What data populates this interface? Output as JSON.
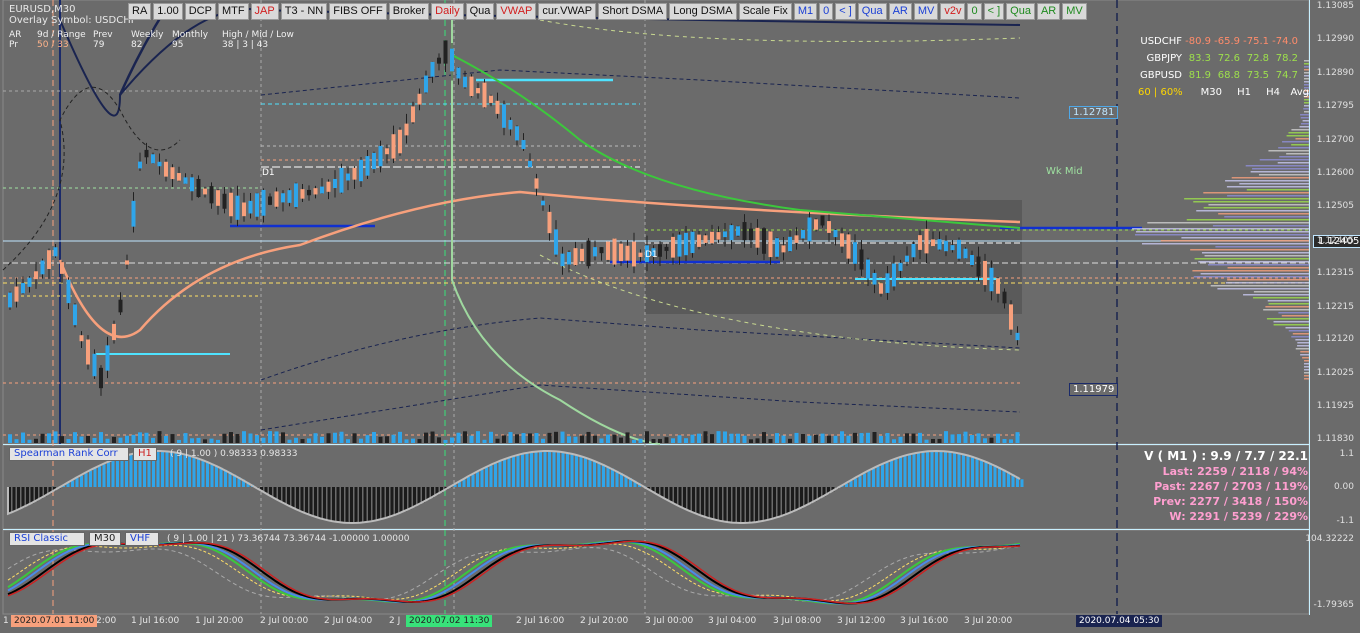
{
  "symbol_info": {
    "title": "EURUSD,M30",
    "overlay": "Overlay Symbol: USDCHF"
  },
  "stats": {
    "headers": [
      "AR",
      "9d / Range",
      "Prev",
      "Weekly",
      "Monthly",
      "High / Mid / Low"
    ],
    "row_label": "Pr",
    "values": [
      "50 / 33",
      "79",
      "82",
      "95",
      "38 | 3 | 43"
    ]
  },
  "toolbar": [
    {
      "label": "RA",
      "color": "dark"
    },
    {
      "label": "1.00",
      "color": "dark"
    },
    {
      "label": "DCP",
      "color": "dark"
    },
    {
      "label": "MTF",
      "color": "dark"
    },
    {
      "label": "JAP",
      "color": "red"
    },
    {
      "label": "T3 - NN",
      "color": "dark"
    },
    {
      "label": "FIBS OFF",
      "color": "dark"
    },
    {
      "label": "Broker",
      "color": "dark"
    },
    {
      "label": "Daily",
      "color": "red"
    },
    {
      "label": "Qua",
      "color": "dark"
    },
    {
      "label": "VWAP",
      "color": "red"
    },
    {
      "label": "cur.VWAP",
      "color": "dark"
    },
    {
      "label": "Short DSMA",
      "color": "dark"
    },
    {
      "label": "Long DSMA",
      "color": "dark"
    },
    {
      "label": "Scale Fix",
      "color": "dark"
    },
    {
      "label": "M1",
      "color": "blue"
    },
    {
      "label": "0",
      "color": "blue"
    },
    {
      "label": "< ]",
      "color": "blue"
    },
    {
      "label": "Qua",
      "color": "blue"
    },
    {
      "label": "AR",
      "color": "blue"
    },
    {
      "label": "MV",
      "color": "blue"
    },
    {
      "label": "v2v",
      "color": "red"
    },
    {
      "label": "0",
      "color": "green"
    },
    {
      "label": "< ]",
      "color": "green"
    },
    {
      "label": "Qua",
      "color": "green"
    },
    {
      "label": "AR",
      "color": "green"
    },
    {
      "label": "MV",
      "color": "green"
    }
  ],
  "correlation": {
    "rows": [
      {
        "symbol": "USDCHF",
        "values": [
          "-80.9",
          "-65.9",
          "-75.1",
          "-74.0"
        ],
        "tone": "neg"
      },
      {
        "symbol": "GBPJPY",
        "values": [
          "83.3",
          "72.6",
          "72.8",
          "78.2"
        ],
        "tone": "pos"
      },
      {
        "symbol": "GBPUSD",
        "values": [
          "81.9",
          "68.8",
          "73.5",
          "74.7"
        ],
        "tone": "pos"
      }
    ],
    "footer": [
      "60 | 60%",
      "M30",
      "H1",
      "H4",
      "Avg"
    ]
  },
  "price_axis": [
    "1.13085",
    "1.12990",
    "1.12890",
    "1.12795",
    "1.12700",
    "1.12600",
    "1.12505",
    "1.12405",
    "1.12315",
    "1.12215",
    "1.12120",
    "1.12025",
    "1.11925",
    "1.11830"
  ],
  "price_boxes": {
    "upper": "1.12781",
    "lower": "1.11979",
    "current": "1.12405"
  },
  "chart_labels": {
    "wk_mid": "Wk Mid",
    "d1_a": "D1",
    "d1_b": "D1"
  },
  "spearman": {
    "name": "Spearman Rank Corr",
    "tf": "H1",
    "params": "( 9 | 1.00 ) 0.98333 0.98333",
    "axis": [
      "1.1",
      "0.00",
      "-1.1"
    ]
  },
  "volume_stats": {
    "title": "V ( M1 ) : 9.9 / 7.7 / 22.1",
    "lines": [
      "Last: 2259 / 2118 / 94%",
      "Past: 2267 / 2703 / 119%",
      "Prev: 2277 / 3418 / 150%",
      "W: 2291 / 5239 / 229%"
    ]
  },
  "rsi": {
    "name": "RSI Classic",
    "tf": "M30",
    "mode": "VHF",
    "params": "( 9 | 1.00 | 21 ) 73.36744 73.36744 -1.00000 1.00000",
    "axis": [
      "104.32222",
      "-1.79365"
    ]
  },
  "time_axis": {
    "labels": [
      "1",
      "2:00",
      "1 Jul 16:00",
      "1 Jul 20:00",
      "2 Jul 00:00",
      "2 Jul 04:00",
      "2 J",
      "2 Jul 16:00",
      "2 Jul 20:00",
      "3 Jul 00:00",
      "3 Jul 04:00",
      "3 Jul 08:00",
      "3 Jul 12:00",
      "3 Jul 16:00",
      "3 Jul 20:00"
    ],
    "badge_left": "2020.07.01 11:00",
    "badge_mid": "2020.07.02 11:30",
    "badge_right": "2020.07.04 05:30"
  }
}
